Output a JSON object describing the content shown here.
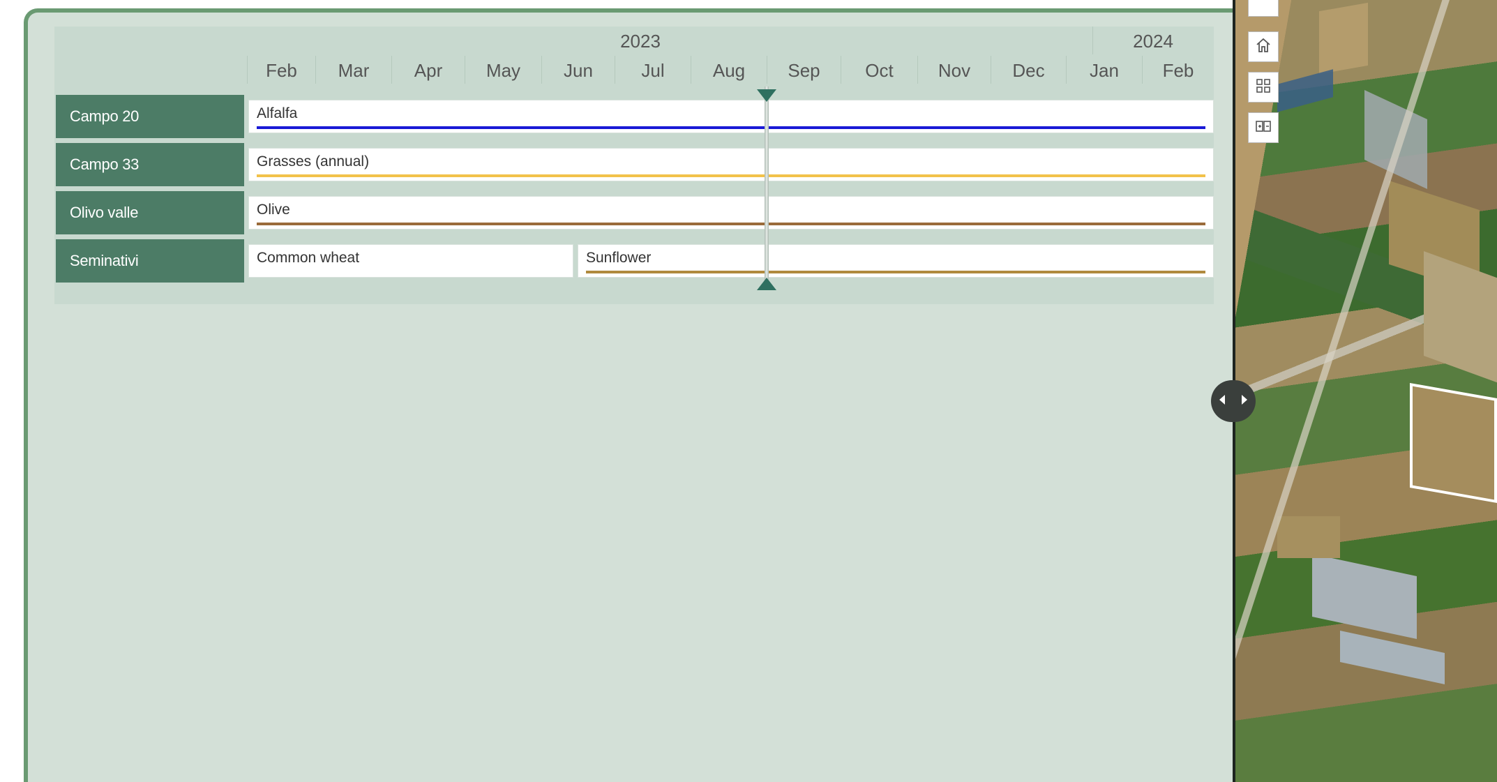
{
  "timeline": {
    "years": [
      "2023",
      "2024"
    ],
    "months": [
      "Feb",
      "Mar",
      "Apr",
      "May",
      "Jun",
      "Jul",
      "Aug",
      "Sep",
      "Oct",
      "Nov",
      "Dec",
      "Jan",
      "Feb"
    ],
    "rows": [
      {
        "field": "Campo 20",
        "crops": [
          {
            "name": "Alfalfa",
            "color": "#1a1ad6"
          }
        ]
      },
      {
        "field": "Campo 33",
        "crops": [
          {
            "name": "Grasses (annual)",
            "color": "#f2c24a"
          }
        ]
      },
      {
        "field": "Olivo valle",
        "crops": [
          {
            "name": "Olive",
            "color": "#9a6b3a"
          }
        ]
      },
      {
        "field": "Seminativi",
        "crops": [
          {
            "name": "Common wheat",
            "color": null
          },
          {
            "name": "Sunflower",
            "color": "#b08a3e"
          }
        ]
      }
    ]
  },
  "map": {
    "buttons": [
      {
        "icon": "home-icon"
      },
      {
        "icon": "grid-icon"
      },
      {
        "icon": "compare-icon"
      }
    ]
  },
  "splitter": {
    "icon": "left-right-arrows-icon"
  },
  "colors": {
    "panel_bg": "#d3e0d7",
    "label_bg": "#4c7c66",
    "accent": "#2f7060",
    "border": "#6a9a72"
  }
}
